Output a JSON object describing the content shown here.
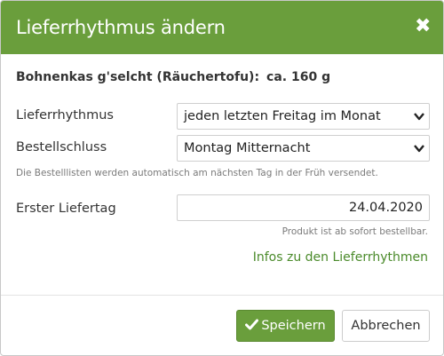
{
  "dialog": {
    "title": "Lieferrhythmus ändern",
    "close_glyph": "✖",
    "header_color": "#6a9e3c"
  },
  "product": {
    "name": "Bohnenkas g'selcht (Räuchertofu):",
    "quantity": "ca. 160 g"
  },
  "form": {
    "rhythm": {
      "label": "Lieferrhythmus",
      "selected": "jeden letzten Freitag im Monat"
    },
    "deadline": {
      "label": "Bestellschluss",
      "selected": "Montag Mitternacht"
    },
    "help_text": "Die Bestelllisten werden automatisch am nächsten Tag in der Früh versendet.",
    "first_delivery": {
      "label": "Erster Liefertag",
      "value": "24.04.2020"
    },
    "availability_note": "Produkt ist ab sofort bestellbar.",
    "info_link": "Infos zu den Lieferrhythmen"
  },
  "footer": {
    "save_label": "Speichern",
    "cancel_label": "Abbrechen"
  },
  "icons": {
    "close": "close-icon",
    "check": "check-icon",
    "chevron": "chevron-down-icon"
  }
}
